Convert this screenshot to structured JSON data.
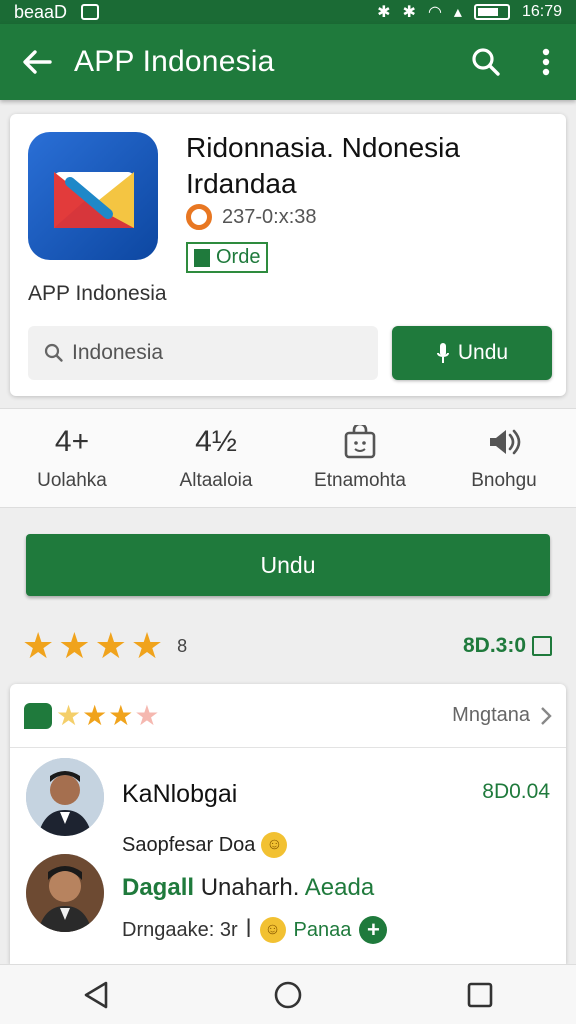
{
  "status_bar": {
    "left_text": "beaaD",
    "time": "16:79"
  },
  "app_bar": {
    "title": "APP Indonesia"
  },
  "app_info": {
    "name": "Ridonnasia. Ndonesia Irdandaa",
    "meta": "237-0:x:38",
    "badge": "Orde",
    "developer": "APP Indonesia",
    "search_placeholder": "Indonesia",
    "install_label": "Undu"
  },
  "stats": [
    {
      "top": "4+",
      "label": "Uolahka"
    },
    {
      "top": "4½",
      "label": "Altaaloia"
    },
    {
      "top": "",
      "label": "Etnamohta"
    },
    {
      "top": "",
      "label": "Bnohgu"
    }
  ],
  "main_button": {
    "label": "Undu"
  },
  "rating": {
    "stars": 4,
    "count": "8",
    "score": "8D.3:0"
  },
  "reviews_header": {
    "stars": 4,
    "more_label": "Mngtana"
  },
  "review1": {
    "name": "KaNlobgai",
    "date": "8D0.04",
    "text": "Saopfesar Doa"
  },
  "review2": {
    "title_bold": "Dagall",
    "title_normal": "Unaharh.",
    "title_green": "Aeada",
    "meta": "Drngaake: 3r",
    "meta_suffix": "Panaa"
  },
  "colors": {
    "primary": "#1f7a3c",
    "status_bar": "#1b6b35",
    "star": "#f0a31c"
  }
}
